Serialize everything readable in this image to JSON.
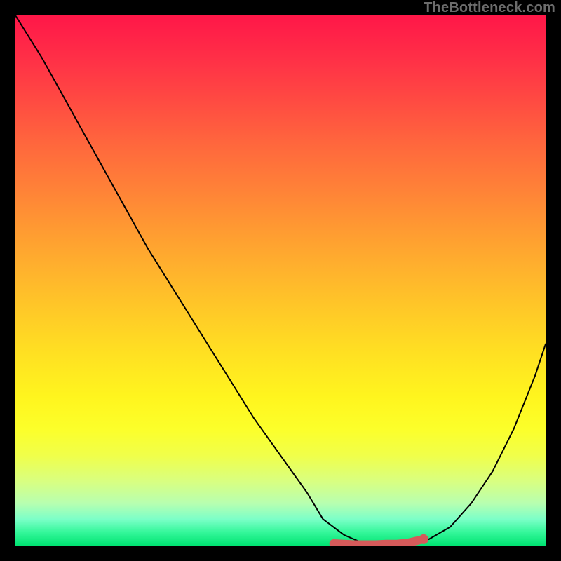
{
  "watermark": "TheBottleneck.com",
  "chart_data": {
    "type": "line",
    "title": "",
    "xlabel": "",
    "ylabel": "",
    "xlim": [
      0,
      100
    ],
    "ylim": [
      0,
      100
    ],
    "legend": false,
    "grid": false,
    "background": "rainbow-gradient",
    "series": [
      {
        "name": "bottleneck-curve",
        "color": "#000000",
        "x": [
          0,
          5,
          10,
          15,
          20,
          25,
          30,
          35,
          40,
          45,
          50,
          55,
          58,
          62,
          65,
          68,
          72,
          75,
          78,
          82,
          86,
          90,
          94,
          98,
          100
        ],
        "y": [
          100,
          92,
          83,
          74,
          65,
          56,
          48,
          40,
          32,
          24,
          17,
          10,
          5,
          2,
          0.7,
          0.3,
          0.3,
          0.5,
          1.2,
          3.5,
          8,
          14,
          22,
          32,
          38
        ]
      },
      {
        "name": "optimal-range-marker",
        "color": "#d55a5a",
        "type": "scatter",
        "x": [
          60,
          62,
          64,
          66,
          68,
          70,
          72,
          74,
          77
        ],
        "y": [
          0.4,
          0.3,
          0.2,
          0.2,
          0.2,
          0.3,
          0.3,
          0.5,
          1.2
        ]
      }
    ]
  },
  "colors": {
    "frame": "#000000",
    "curve": "#000000",
    "marker": "#d55a5a",
    "watermark": "#6c6c6c"
  }
}
